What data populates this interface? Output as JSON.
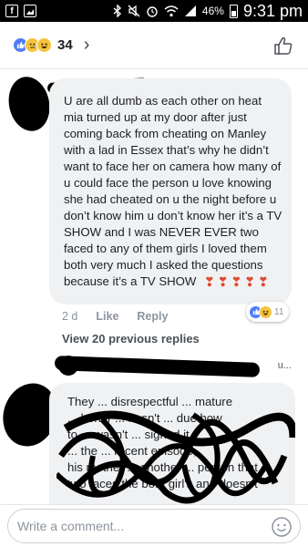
{
  "status_bar": {
    "battery": "46%",
    "time": "9:31 pm"
  },
  "reactions_header": {
    "count": "34",
    "icons": [
      "like-icon",
      "sad-icon",
      "haha-icon"
    ],
    "chevron": "›"
  },
  "comment_1": {
    "text": "U are all dumb as each other on heat mia turned up at my door after just coming back from cheating on Manley with a lad in Essex that’s why he didn’t want to face her on camera how many of u could face the person u love knowing she had cheated on u the night before u don’t know him u don’t know her it’s a TV SHOW and I was NEVER EVER two faced to any of them girls I loved them both very much I asked the questions because it’s a TV SHOW",
    "hearts": [
      "❣",
      "❣",
      "❣",
      "❣",
      "❣"
    ],
    "time": "2 d",
    "like_label": "Like",
    "reply_label": "Reply",
    "reaction_count": "11",
    "view_replies": "View 20 previous replies"
  },
  "reply_preview": {
    "name_suffix": "u..."
  },
  "comment_2": {
    "text": "They ... disrespectful ... mature\n... honor ... hasn't ... due how\nto ... wasn't ... signed it\n... the ... recent episode,\nhis mother ... another ... person  that\ntwo faces the both girl's  and doesn't"
  },
  "composer": {
    "placeholder": "Write a comment..."
  },
  "colors": {
    "like_blue": "#4f7cf7",
    "bubble_gray": "#f0f1f3",
    "heart_red": "#e04a2f"
  }
}
